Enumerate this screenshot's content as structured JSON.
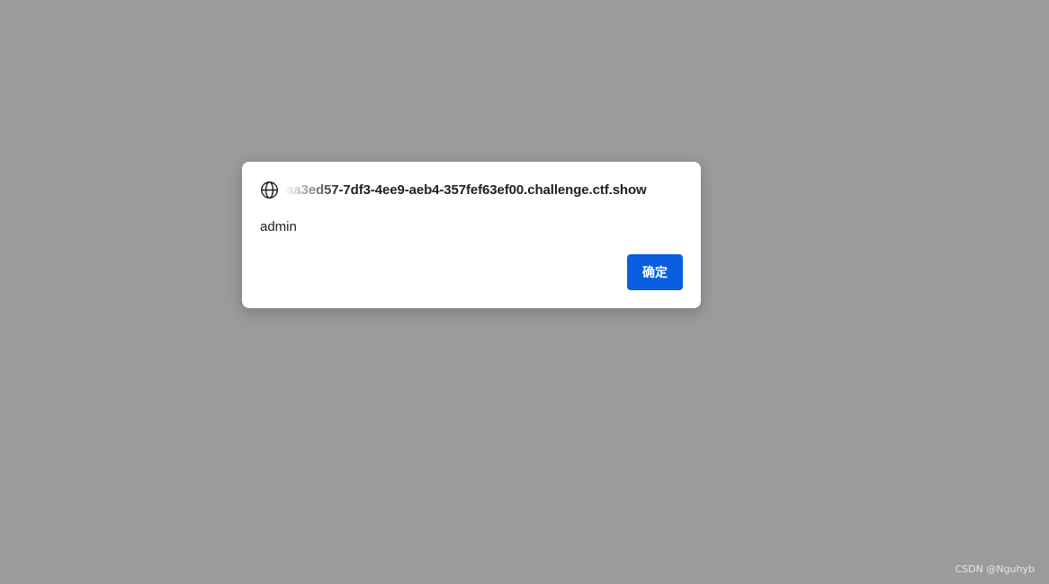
{
  "dialog": {
    "origin": "aa3ed57-7df3-4ee9-aeb4-357fef63ef00.challenge.ctf.show",
    "message": "admin",
    "ok_label": "确定",
    "icon": "globe-icon"
  },
  "watermark": "CSDN @Nguhyb",
  "colors": {
    "backdrop": "#9b9b9d",
    "button": "#0a5fe0",
    "button_text": "#ffffff"
  }
}
